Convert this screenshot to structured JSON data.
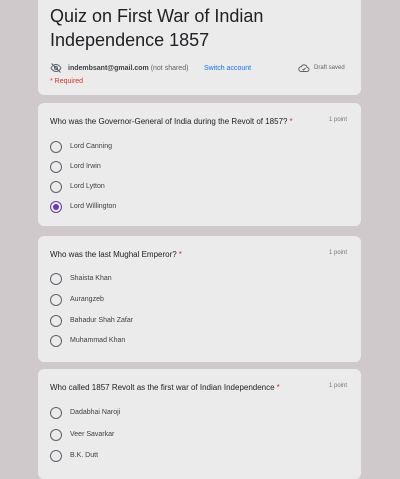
{
  "header": {
    "title": "Quiz on First War of Indian Independence 1857",
    "email": "indembsant@gmail.com",
    "not_shared": "(not shared)",
    "switch_account": "Switch account",
    "draft_status": "Draft saved",
    "required_note": "* Required"
  },
  "questions": [
    {
      "text": "Who was the Governor-General of India during the Revolt of 1857?",
      "required_mark": "*",
      "points": "1 point",
      "options": [
        {
          "label": "Lord Canning",
          "selected": false
        },
        {
          "label": "Lord Irwin",
          "selected": false
        },
        {
          "label": "Lord Lytton",
          "selected": false
        },
        {
          "label": "Lord Willington",
          "selected": true
        }
      ]
    },
    {
      "text": "Who was the last Mughal Emperor?",
      "required_mark": "*",
      "points": "1 point",
      "options": [
        {
          "label": "Shaista Khan",
          "selected": false
        },
        {
          "label": "Aurangzeb",
          "selected": false
        },
        {
          "label": "Bahadur Shah Zafar",
          "selected": false
        },
        {
          "label": "Muhammad Khan",
          "selected": false
        }
      ]
    },
    {
      "text": "Who called 1857 Revolt as the first war of Indian Independence",
      "required_mark": "*",
      "points": "1 point",
      "options": [
        {
          "label": "Dadabhai Naroji",
          "selected": false
        },
        {
          "label": "Veer Savarkar",
          "selected": false
        },
        {
          "label": "B.K. Dutt",
          "selected": false
        }
      ]
    }
  ],
  "colors": {
    "accent": "#673ab7",
    "link": "#1a73e8",
    "required": "#d93025",
    "card": "#ebebeb"
  },
  "icons": {
    "account": "eye-off-icon",
    "draft": "cloud-done-icon"
  }
}
